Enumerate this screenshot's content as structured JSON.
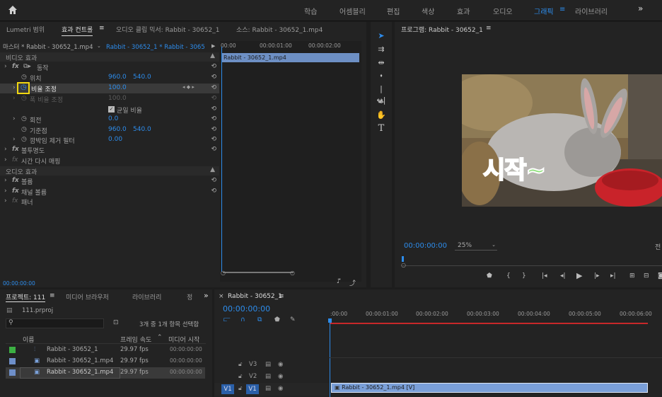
{
  "topbar": {
    "workspaces": [
      "학습",
      "어셈블리",
      "편집",
      "색상",
      "효과",
      "오디오",
      "그래픽",
      "라이브러리"
    ],
    "active": "그래픽",
    "more": "»"
  },
  "effect_panel": {
    "tabs": [
      "Lumetri 범위",
      "효과 컨트롤",
      "오디오 클립 믹서: Rabbit - 30652_1",
      "소스: Rabbit - 30652_1.mp4"
    ],
    "menu": "≡",
    "source_label": "마스터 * Rabbit - 30652_1.mp4",
    "clip_label": "Rabbit - 30652_1 * Rabbit - 30652...",
    "play_icon": "▶",
    "video_effects": "비디오 효과",
    "motion": "동작",
    "position": {
      "label": "위치",
      "x": "960.0",
      "y": "540.0"
    },
    "scale": {
      "label": "비율 조정",
      "v": "100.0"
    },
    "scale_width": {
      "label": "폭 비율 조정",
      "v": "100.0"
    },
    "uniform": "균일 비율",
    "rotation": {
      "label": "회전",
      "v": "0.0"
    },
    "anchor": {
      "label": "기준점",
      "x": "960.0",
      "y": "540.0"
    },
    "antiflicker": {
      "label": "깜박임 제거 필터",
      "v": "0.00"
    },
    "opacity": "불투명도",
    "time_remap": "시간 다시 매핑",
    "audio_effects": "오디오 효과",
    "volume": "볼륨",
    "channel_volume": "채널 볼륨",
    "panner": "패너",
    "timecode": "00:00:00:00",
    "ruler": [
      "00:00",
      "00:00:01:00",
      "00:00:02:00"
    ],
    "clip_name": "Rabbit - 30652_1.mp4",
    "reset": "⟲"
  },
  "program": {
    "title": "프로그램: Rabbit - 30652_1",
    "timecode": "00:00:00:00",
    "zoom": "25%",
    "quality": "전",
    "overlay_text": "시작~"
  },
  "project": {
    "tabs": [
      "프로젝트: 111",
      "미디어 브라우저",
      "라이브러리",
      "정"
    ],
    "file": "111.prproj",
    "selection": "3개 중 1개 항목 선택함",
    "columns": [
      "이름",
      "프레임 속도",
      "미디어 시작"
    ],
    "items": [
      {
        "name": "Rabbit - 30652_1",
        "fps": "29.97 fps",
        "start": "00:00:00:00",
        "color": "#3cb043",
        "type": "sequence"
      },
      {
        "name": "Rabbit - 30652_1.mp4",
        "fps": "29.97 fps",
        "start": "00:00:00:00",
        "color": "#6e8fc9",
        "type": "clip"
      },
      {
        "name": "Rabbit - 30652_1.mp4",
        "fps": "29.97 fps",
        "start": "00:00:00:00",
        "color": "#6e8fc9",
        "type": "clip"
      }
    ]
  },
  "timeline": {
    "tab": "Rabbit - 30652_1",
    "timecode": "00:00:00:00",
    "ruler": [
      ":00:00",
      "00:00:01:00",
      "00:00:02:00",
      "00:00:03:00",
      "00:00:04:00",
      "00:00:05:00",
      "00:00:06:00"
    ],
    "tracks": [
      "V3",
      "V2",
      "V1"
    ],
    "source_patch": "V1",
    "clip": "Rabbit - 30652_1.mp4 [V]"
  }
}
